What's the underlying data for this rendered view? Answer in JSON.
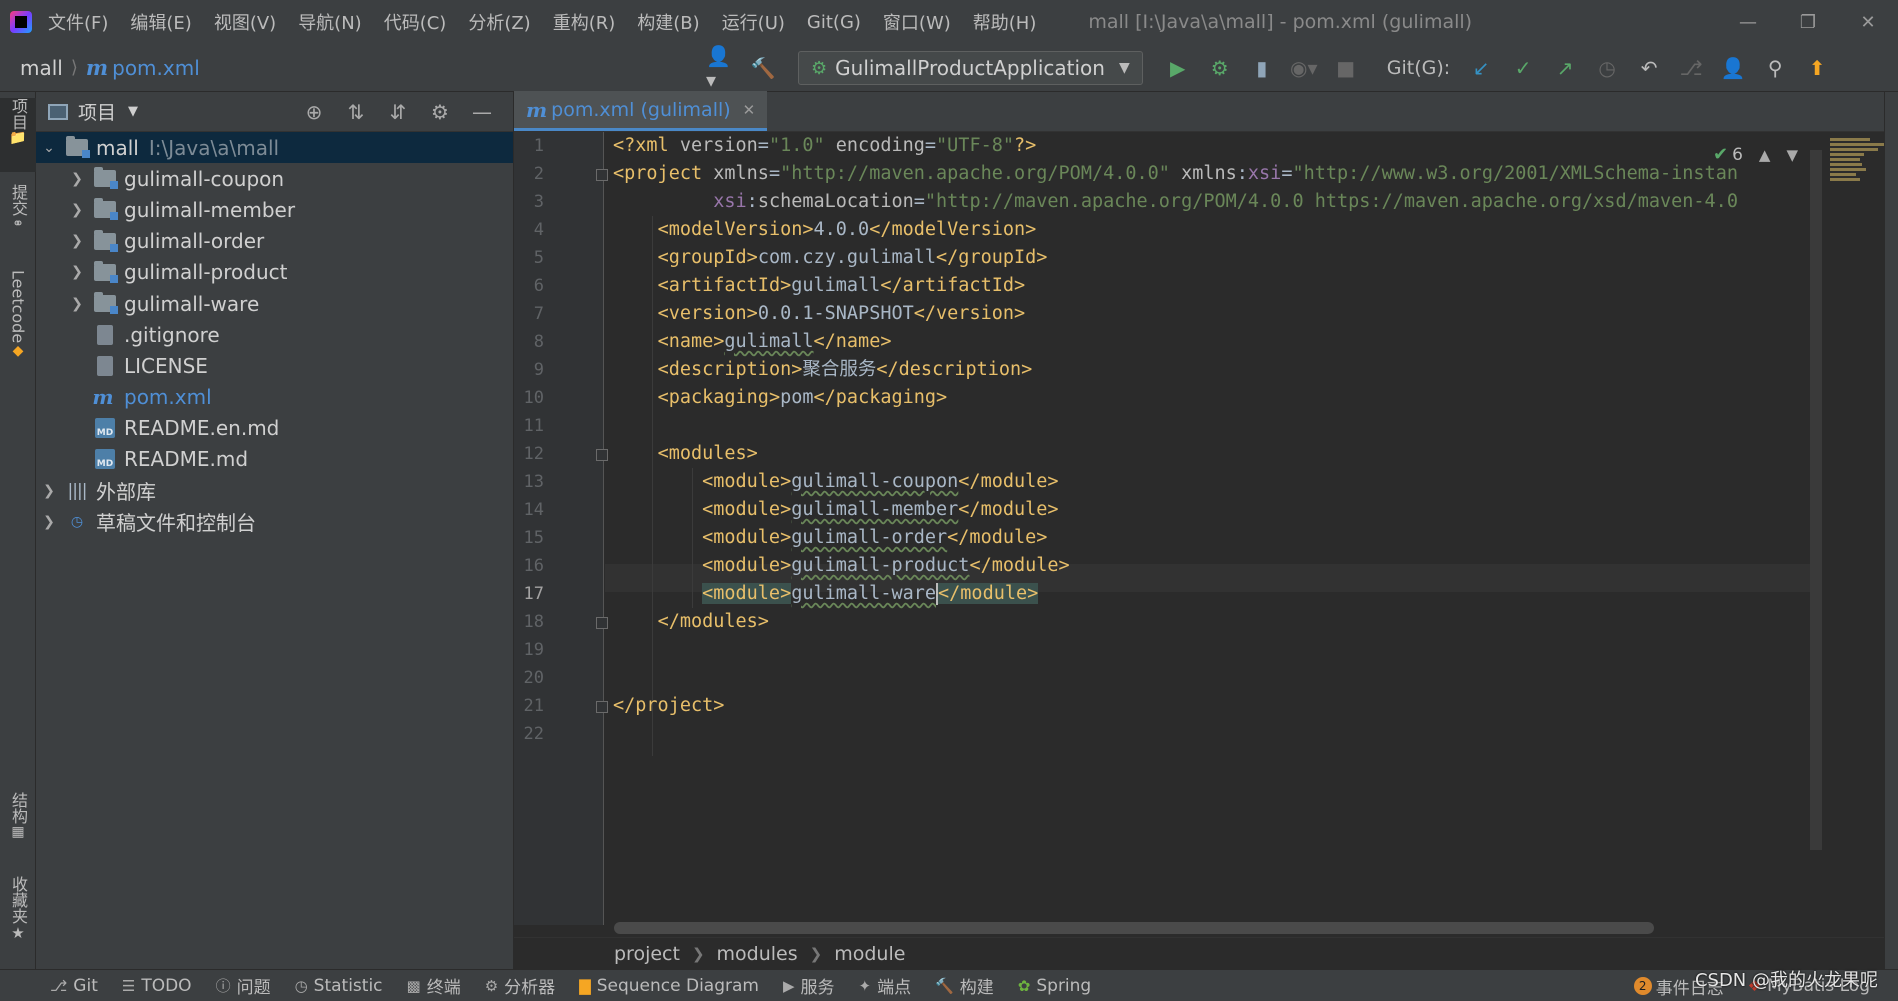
{
  "menu": {
    "items": [
      "文件(F)",
      "编辑(E)",
      "视图(V)",
      "导航(N)",
      "代码(C)",
      "分析(Z)",
      "重构(R)",
      "构建(B)",
      "运行(U)",
      "Git(G)",
      "窗口(W)",
      "帮助(H)"
    ],
    "window_title": "mall [I:\\Java\\a\\mall] - pom.xml (gulimall)"
  },
  "toolbar": {
    "project": "mall",
    "file": "pom.xml",
    "run_config": "GulimallProductApplication",
    "git_label": "Git(G):"
  },
  "left_strip": {
    "project_tab": "项目",
    "commit_tab": "提交",
    "leetcode_tab": "Leetcode",
    "structure_tab": "结构",
    "favorites_tab": "收藏夹"
  },
  "project_panel": {
    "title": "项目",
    "root": {
      "name": "mall",
      "path": "I:\\Java\\a\\mall"
    },
    "items": [
      {
        "name": "gulimall-coupon",
        "type": "module"
      },
      {
        "name": "gulimall-member",
        "type": "module"
      },
      {
        "name": "gulimall-order",
        "type": "module"
      },
      {
        "name": "gulimall-product",
        "type": "module"
      },
      {
        "name": "gulimall-ware",
        "type": "module"
      },
      {
        "name": ".gitignore",
        "type": "file"
      },
      {
        "name": "LICENSE",
        "type": "file"
      },
      {
        "name": "pom.xml",
        "type": "maven"
      },
      {
        "name": "README.en.md",
        "type": "md"
      },
      {
        "name": "README.md",
        "type": "md"
      }
    ],
    "external_libraries": "外部库",
    "scratches": "草稿文件和控制台"
  },
  "editor": {
    "tab_label": "pom.xml (gulimall)",
    "inspection_count": "6",
    "current_line": 17,
    "line_numbers": [
      "1",
      "2",
      "3",
      "4",
      "5",
      "6",
      "7",
      "8",
      "9",
      "10",
      "11",
      "12",
      "13",
      "14",
      "15",
      "16",
      "17",
      "18",
      "19",
      "20",
      "21",
      "22"
    ],
    "code": {
      "xml_decl_version": "1.0",
      "xml_decl_encoding": "UTF-8",
      "project_xmlns": "http://maven.apache.org/POM/4.0.0",
      "project_xsi": "http://www.w3.org/2001/XMLSchema-instan",
      "schema_location": "http://maven.apache.org/POM/4.0.0 https://maven.apache.org/xsd/maven-4.0",
      "model_version": "4.0.0",
      "group_id": "com.czy.gulimall",
      "artifact_id": "gulimall",
      "version": "0.0.1-SNAPSHOT",
      "name": "gulimall",
      "description": "聚合服务",
      "packaging": "pom",
      "modules": [
        "gulimall-coupon",
        "gulimall-member",
        "gulimall-order",
        "gulimall-product",
        "gulimall-ware"
      ]
    },
    "breadcrumb": [
      "project",
      "modules",
      "module"
    ]
  },
  "bottom_bar": {
    "items": [
      "Git",
      "TODO",
      "问题",
      "Statistic",
      "终端",
      "分析器",
      "Sequence Diagram",
      "服务",
      "端点",
      "构建",
      "Spring"
    ],
    "event_count": "2",
    "event_log": "事件日志",
    "mybatis_log": "MyBatis Log"
  },
  "watermark": "CSDN @我的火龙果呢"
}
